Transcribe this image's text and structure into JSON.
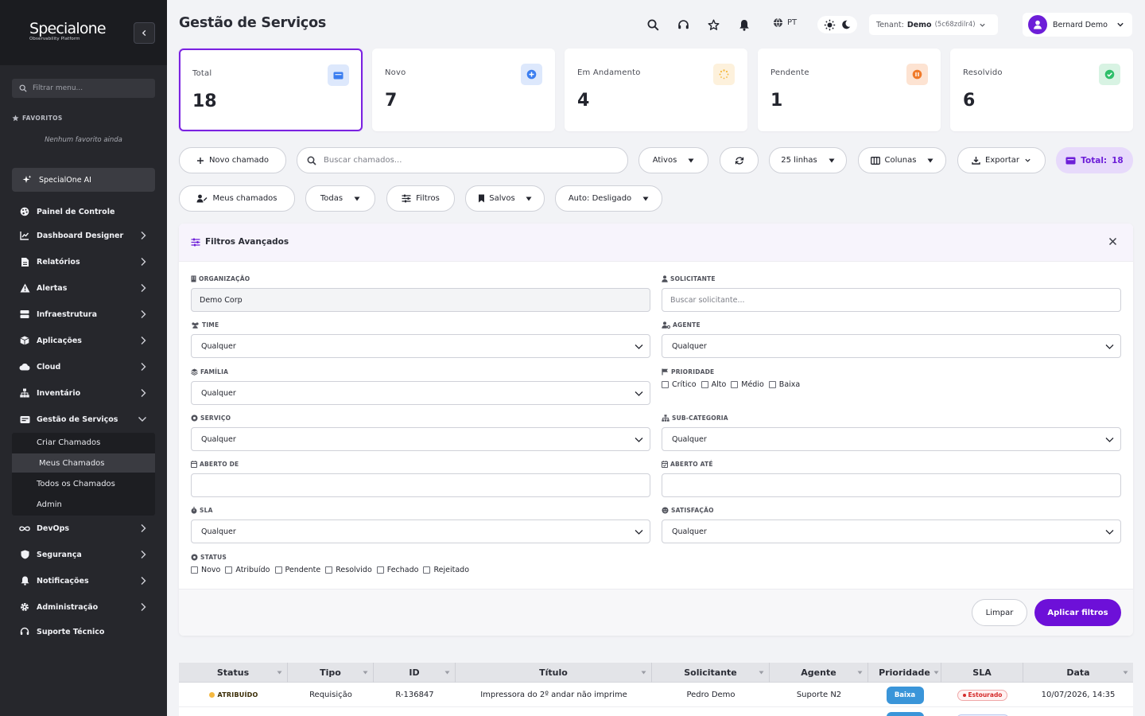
{
  "brand": {
    "name": "Specialone",
    "tagline": "Observability Platform"
  },
  "sidebar": {
    "filter_placeholder": "Filtrar menu...",
    "favorites_title": "FAVORITOS",
    "favorites_empty": "Nenhum favorito ainda",
    "ai_label": "SpecialOne AI",
    "items": [
      {
        "label": "Painel de Controle",
        "icon": "palette-icon"
      },
      {
        "label": "Dashboard Designer",
        "icon": "chart-line-icon"
      },
      {
        "label": "Relatórios",
        "icon": "file-icon"
      },
      {
        "label": "Alertas",
        "icon": "warning-icon"
      },
      {
        "label": "Infraestrutura",
        "icon": "server-icon"
      },
      {
        "label": "Aplicações",
        "icon": "box-icon"
      },
      {
        "label": "Cloud",
        "icon": "cloud-icon"
      },
      {
        "label": "Inventário",
        "icon": "sitemap-icon"
      },
      {
        "label": "Gestão de Serviços",
        "icon": "ticket-icon"
      },
      {
        "label": "DevOps",
        "icon": "infinity-icon"
      },
      {
        "label": "Segurança",
        "icon": "shield-icon"
      },
      {
        "label": "Notificações",
        "icon": "bell-icon"
      },
      {
        "label": "Administração",
        "icon": "gear-icon"
      },
      {
        "label": "Suporte Técnico",
        "icon": "headset-icon"
      }
    ],
    "subitems": [
      "Criar Chamados",
      "Meus Chamados",
      "Todos os Chamados",
      "Admin"
    ]
  },
  "header": {
    "title": "Gestão de Serviços",
    "lang": "PT",
    "tenant_label": "Tenant:",
    "tenant_name": "Demo",
    "tenant_id": "(5c68zdilr4)",
    "user_name": "Bernard Demo"
  },
  "stats": [
    {
      "label": "Total",
      "value": "18",
      "color": "#3b7ef0"
    },
    {
      "label": "Novo",
      "value": "7",
      "color": "#3b7ef0"
    },
    {
      "label": "Em Andamento",
      "value": "4",
      "color": "#f5b941"
    },
    {
      "label": "Pendente",
      "value": "1",
      "color": "#f07a2a"
    },
    {
      "label": "Resolvido",
      "value": "6",
      "color": "#2fbf6a"
    }
  ],
  "toolbar": {
    "new_ticket": "Novo chamado",
    "search_placeholder": "Buscar chamados...",
    "active": "Ativos",
    "rows": "25 linhas",
    "columns": "Colunas",
    "export": "Exportar",
    "total_label": "Total:",
    "total_value": "18",
    "my_tickets": "Meus chamados",
    "all": "Todas",
    "filters": "Filtros",
    "saved": "Salvos",
    "auto": "Auto: Desligado"
  },
  "filters": {
    "title": "Filtros Avançados",
    "organization_label": "ORGANIZAÇÃO",
    "organization_value": "Demo Corp",
    "requester_label": "SOLICITANTE",
    "requester_placeholder": "Buscar solicitante...",
    "team_label": "TIME",
    "team_value": "Qualquer",
    "agent_label": "AGENTE",
    "agent_value": "Qualquer",
    "family_label": "FAMÍLIA",
    "family_value": "Qualquer",
    "priority_label": "PRIORIDADE",
    "priority_options": [
      "Crítico",
      "Alto",
      "Médio",
      "Baixa"
    ],
    "service_label": "SERVIÇO",
    "service_value": "Qualquer",
    "subcategory_label": "SUB-CATEGORIA",
    "subcategory_value": "Qualquer",
    "opened_from_label": "ABERTO DE",
    "opened_to_label": "ABERTO ATÉ",
    "sla_label": "SLA",
    "sla_value": "Qualquer",
    "satisfaction_label": "SATISFAÇÃO",
    "satisfaction_value": "Qualquer",
    "status_label": "STATUS",
    "status_options": [
      "Novo",
      "Atribuído",
      "Pendente",
      "Resolvido",
      "Fechado",
      "Rejeitado"
    ],
    "clear": "Limpar",
    "apply": "Aplicar filtros"
  },
  "table": {
    "columns": [
      "Status",
      "Tipo",
      "ID",
      "Título",
      "Solicitante",
      "Agente",
      "Prioridade",
      "SLA",
      "Data"
    ],
    "rows": [
      {
        "status": "ATRIBUÍDO",
        "type": "Requisição",
        "id": "R-136847",
        "title": "Impressora do 2º andar não imprime",
        "requester": "Pedro Demo",
        "agent": "Suporte N2",
        "priority": "Baixa",
        "sla": "Estourado",
        "date": "10/07/2026, 14:35"
      }
    ]
  }
}
